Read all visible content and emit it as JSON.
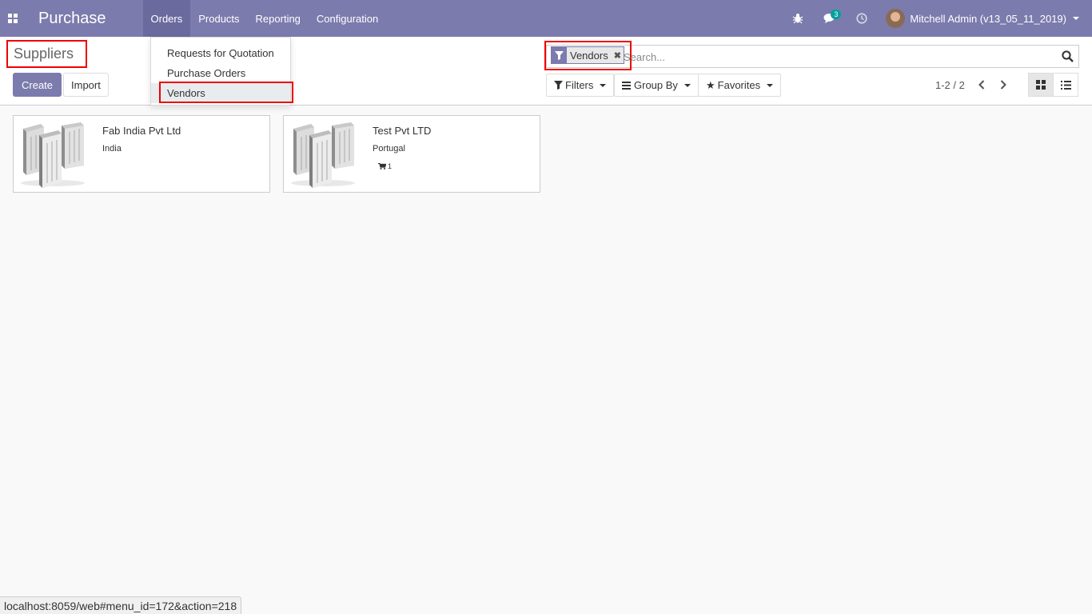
{
  "navbar": {
    "app_name": "Purchase",
    "menu": [
      "Orders",
      "Products",
      "Reporting",
      "Configuration"
    ],
    "active_menu": "Orders",
    "messages_count": "3",
    "user_name": "Mitchell Admin (v13_05_11_2019)"
  },
  "orders_menu": {
    "items": [
      "Requests for Quotation",
      "Purchase Orders",
      "Vendors"
    ],
    "active_item": "Vendors"
  },
  "control_panel": {
    "breadcrumb": "Suppliers",
    "create_label": "Create",
    "import_label": "Import",
    "search": {
      "facet": "Vendors",
      "placeholder": "Search..."
    },
    "filters_label": "Filters",
    "group_by_label": "Group By",
    "favorites_label": "Favorites",
    "pager": "1-2 / 2",
    "active_view": "kanban"
  },
  "vendors": [
    {
      "name": "Fab India Pvt Ltd",
      "country": "India",
      "po_count": ""
    },
    {
      "name": "Test Pvt LTD",
      "country": "Portugal",
      "po_count": "1"
    }
  ],
  "statusbar": {
    "url": "localhost:8059/web#menu_id=172&action=218"
  },
  "colors": {
    "brand": "#7c7bad",
    "badge": "#00a09d",
    "highlight": "#ee0000"
  }
}
